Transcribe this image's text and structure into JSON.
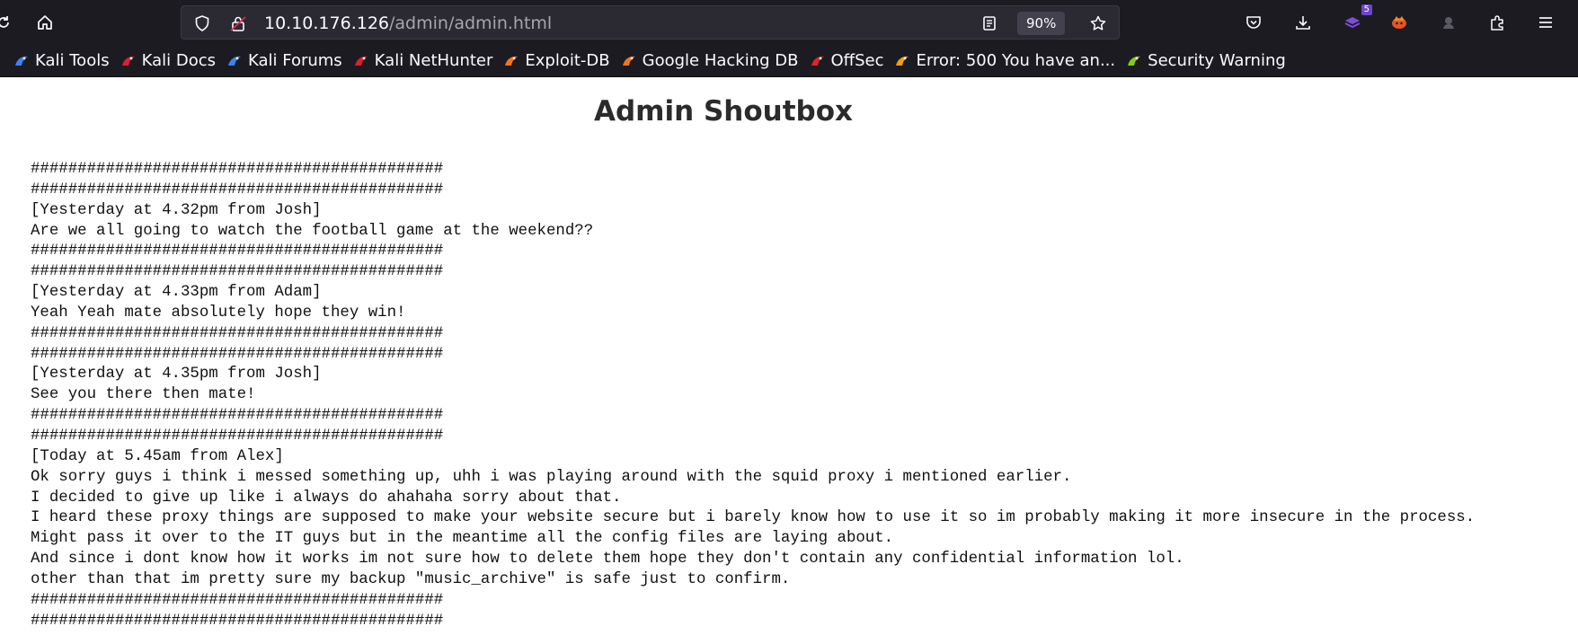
{
  "browser": {
    "url_host": "10.10.176.126",
    "url_path": "/admin/admin.html",
    "zoom": "90%",
    "extension_badge": "5"
  },
  "bookmarks": [
    {
      "label": "Kali Tools",
      "icon": "kali-dragon-icon",
      "color": "#3b82f6"
    },
    {
      "label": "Kali Docs",
      "icon": "kali-docs-icon",
      "color": "#e11d2e"
    },
    {
      "label": "Kali Forums",
      "icon": "kali-forums-icon",
      "color": "#3b82f6"
    },
    {
      "label": "Kali NetHunter",
      "icon": "nethunter-icon",
      "color": "#e11d2e"
    },
    {
      "label": "Exploit-DB",
      "icon": "exploit-db-icon",
      "color": "#f97316"
    },
    {
      "label": "Google Hacking DB",
      "icon": "ghdb-icon",
      "color": "#f97316"
    },
    {
      "label": "OffSec",
      "icon": "offsec-icon",
      "color": "#dc2626"
    },
    {
      "label": "Error: 500 You have an...",
      "icon": "joomla-icon",
      "color": "#f59e0b"
    },
    {
      "label": "Security Warning",
      "icon": "security-warning-icon",
      "color": "#84cc16"
    }
  ],
  "page": {
    "title": "Admin Shoutbox",
    "lines": [
      "############################################",
      "############################################",
      "[Yesterday at 4.32pm from Josh]",
      "Are we all going to watch the football game at the weekend??",
      "############################################",
      "############################################",
      "[Yesterday at 4.33pm from Adam]",
      "Yeah Yeah mate absolutely hope they win!",
      "############################################",
      "############################################",
      "[Yesterday at 4.35pm from Josh]",
      "See you there then mate!",
      "############################################",
      "############################################",
      "[Today at 5.45am from Alex]",
      "Ok sorry guys i think i messed something up, uhh i was playing around with the squid proxy i mentioned earlier.",
      "I decided to give up like i always do ahahaha sorry about that.",
      "I heard these proxy things are supposed to make your website secure but i barely know how to use it so im probably making it more insecure in the process.",
      "Might pass it over to the IT guys but in the meantime all the config files are laying about.",
      "And since i dont know how it works im not sure how to delete them hope they don't contain any confidential information lol.",
      "other than that im pretty sure my backup \"music_archive\" is safe just to confirm.",
      "############################################",
      "############################################"
    ]
  }
}
